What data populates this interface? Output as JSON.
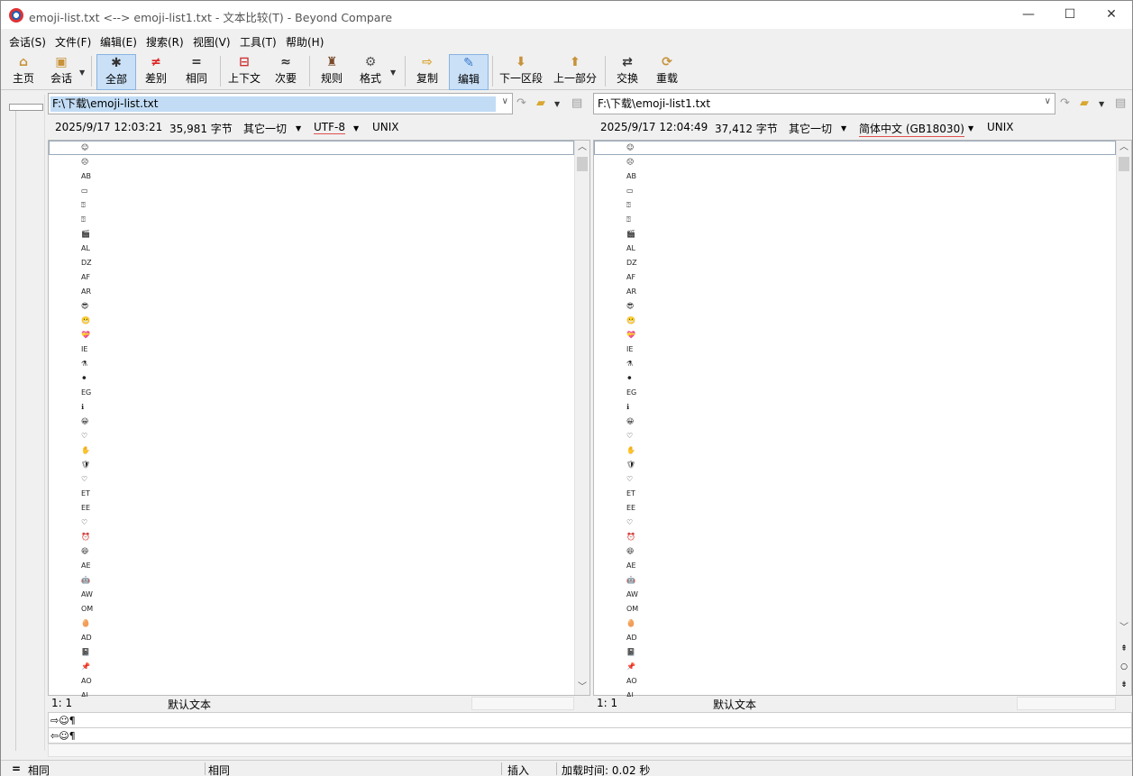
{
  "window": {
    "title": "emoji-list.txt <--> emoji-list1.txt - 文本比较(T) - Beyond Compare",
    "min": "—",
    "max": "☐",
    "close": "✕"
  },
  "menu": [
    "会话(S)",
    "文件(F)",
    "编辑(E)",
    "搜索(R)",
    "视图(V)",
    "工具(T)",
    "帮助(H)"
  ],
  "toolbar": {
    "home": "主页",
    "session": "会话",
    "all": "全部",
    "diffs": "差别",
    "same": "相同",
    "context": "上下文",
    "minor": "次要",
    "rules": "规则",
    "format": "格式",
    "copy": "复制",
    "edit": "编辑",
    "next_section": "下一区段",
    "prev_section": "上一部分",
    "swap": "交换",
    "reload": "重载"
  },
  "left": {
    "path": "F:\\下载\\emoji-list.txt",
    "datetime": "2025/9/17 12:03:21",
    "size": "35,981 字节",
    "filter": "其它一切",
    "encoding": "UTF-8",
    "eol": "UNIX",
    "cursor": "1: 1",
    "format": "默认文本"
  },
  "right": {
    "path": "F:\\下载\\emoji-list1.txt",
    "datetime": "2025/9/17 12:04:49",
    "size": "37,412 字节",
    "filter": "其它一切",
    "encoding": "简体中文 (GB18030)",
    "eol": "UNIX",
    "cursor": "1: 1",
    "format": "默认文本"
  },
  "rows": [
    "☺",
    "☹",
    "AB",
    "▭",
    "⍰",
    "⍰",
    "🎬",
    "AL",
    "DZ",
    "AF",
    "AR",
    "😎",
    "😬",
    "💝",
    "IE",
    "⚗",
    "⚫",
    "EG",
    "ℹ",
    "😀",
    "♡",
    "✋",
    "🛡",
    "♡",
    "ET",
    "EE",
    "♡",
    "⏰",
    "😆",
    "AE",
    "🤖",
    "AW",
    "OM",
    "🥚",
    "AD",
    "📓",
    "📌",
    "AO",
    "AI"
  ],
  "compare": {
    "line_a": "⇨☺¶",
    "line_b": "⇦☺¶"
  },
  "status": {
    "sym": "=",
    "left": "相同",
    "mid": "相同",
    "mode": "插入",
    "load": "加载时间: 0.02 秒"
  }
}
